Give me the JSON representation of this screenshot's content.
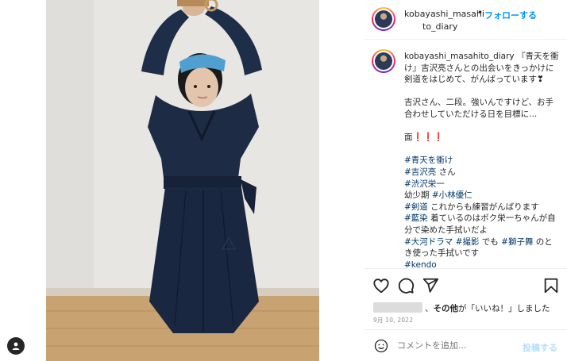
{
  "header": {
    "username_line1": "kobayashi_masahi",
    "username_line2": "to_diary",
    "dot": "•",
    "follow_label": "フォローする",
    "more_label": "···"
  },
  "caption": {
    "username": "kobayashi_masahito_diary",
    "lines": [
      {
        "type": "mixed",
        "parts": [
          {
            "t": "text",
            "v": "『青天を衝け』吉沢亮さんとの出会いをきっかけに剣道をはじめて、がんばっています❣"
          }
        ]
      },
      {
        "type": "gap"
      },
      {
        "type": "mixed",
        "parts": [
          {
            "t": "text",
            "v": "吉沢さん、二段。強いんですけど、お手合わせしていただける日を目標に..."
          }
        ]
      },
      {
        "type": "gap"
      },
      {
        "type": "mixed",
        "parts": [
          {
            "t": "text",
            "v": "面"
          },
          {
            "t": "red",
            "v": "❗❗❗"
          }
        ]
      },
      {
        "type": "gap"
      },
      {
        "type": "mixed",
        "parts": [
          {
            "t": "tag",
            "v": "#青天を衝け"
          }
        ]
      },
      {
        "type": "mixed",
        "parts": [
          {
            "t": "tag",
            "v": "#吉沢亮"
          },
          {
            "t": "text",
            "v": " さん"
          }
        ]
      },
      {
        "type": "mixed",
        "parts": [
          {
            "t": "tag",
            "v": "#渋沢栄一"
          }
        ]
      },
      {
        "type": "mixed",
        "parts": [
          {
            "t": "text",
            "v": "幼少期 "
          },
          {
            "t": "tag",
            "v": "#小林優仁"
          }
        ]
      },
      {
        "type": "mixed",
        "parts": [
          {
            "t": "tag",
            "v": "#剣道"
          },
          {
            "t": "text",
            "v": " これからも練習がんばります"
          }
        ]
      },
      {
        "type": "mixed",
        "parts": [
          {
            "t": "tag",
            "v": "#藍染"
          },
          {
            "t": "text",
            "v": " 着ているのはボク栄一ちゃんが自分で染めた手拭いだよ"
          }
        ]
      },
      {
        "type": "mixed",
        "parts": [
          {
            "t": "tag",
            "v": "#大河ドラマ"
          },
          {
            "t": "text",
            "v": " "
          },
          {
            "t": "tag",
            "v": "#撮影"
          },
          {
            "t": "text",
            "v": " でも "
          },
          {
            "t": "tag",
            "v": "#獅子舞"
          },
          {
            "t": "text",
            "v": " のとき使った手拭いです"
          }
        ]
      },
      {
        "type": "mixed",
        "parts": [
          {
            "t": "tag",
            "v": "#kendo"
          }
        ]
      }
    ]
  },
  "actions": {
    "like_icon": "heart-icon",
    "comment_icon": "comment-icon",
    "share_icon": "share-icon",
    "save_icon": "bookmark-icon"
  },
  "likes": {
    "others_bold": "その他",
    "suffix": "が「いいね！」しました",
    "connector": "、"
  },
  "date": "9月 10, 2022",
  "comment": {
    "placeholder": "コメントを追加...",
    "post_label": "投稿する"
  },
  "colors": {
    "link": "#00376b",
    "follow": "#0095f6",
    "post_disabled": "#b2dffc",
    "muted": "#8e8e8e"
  }
}
